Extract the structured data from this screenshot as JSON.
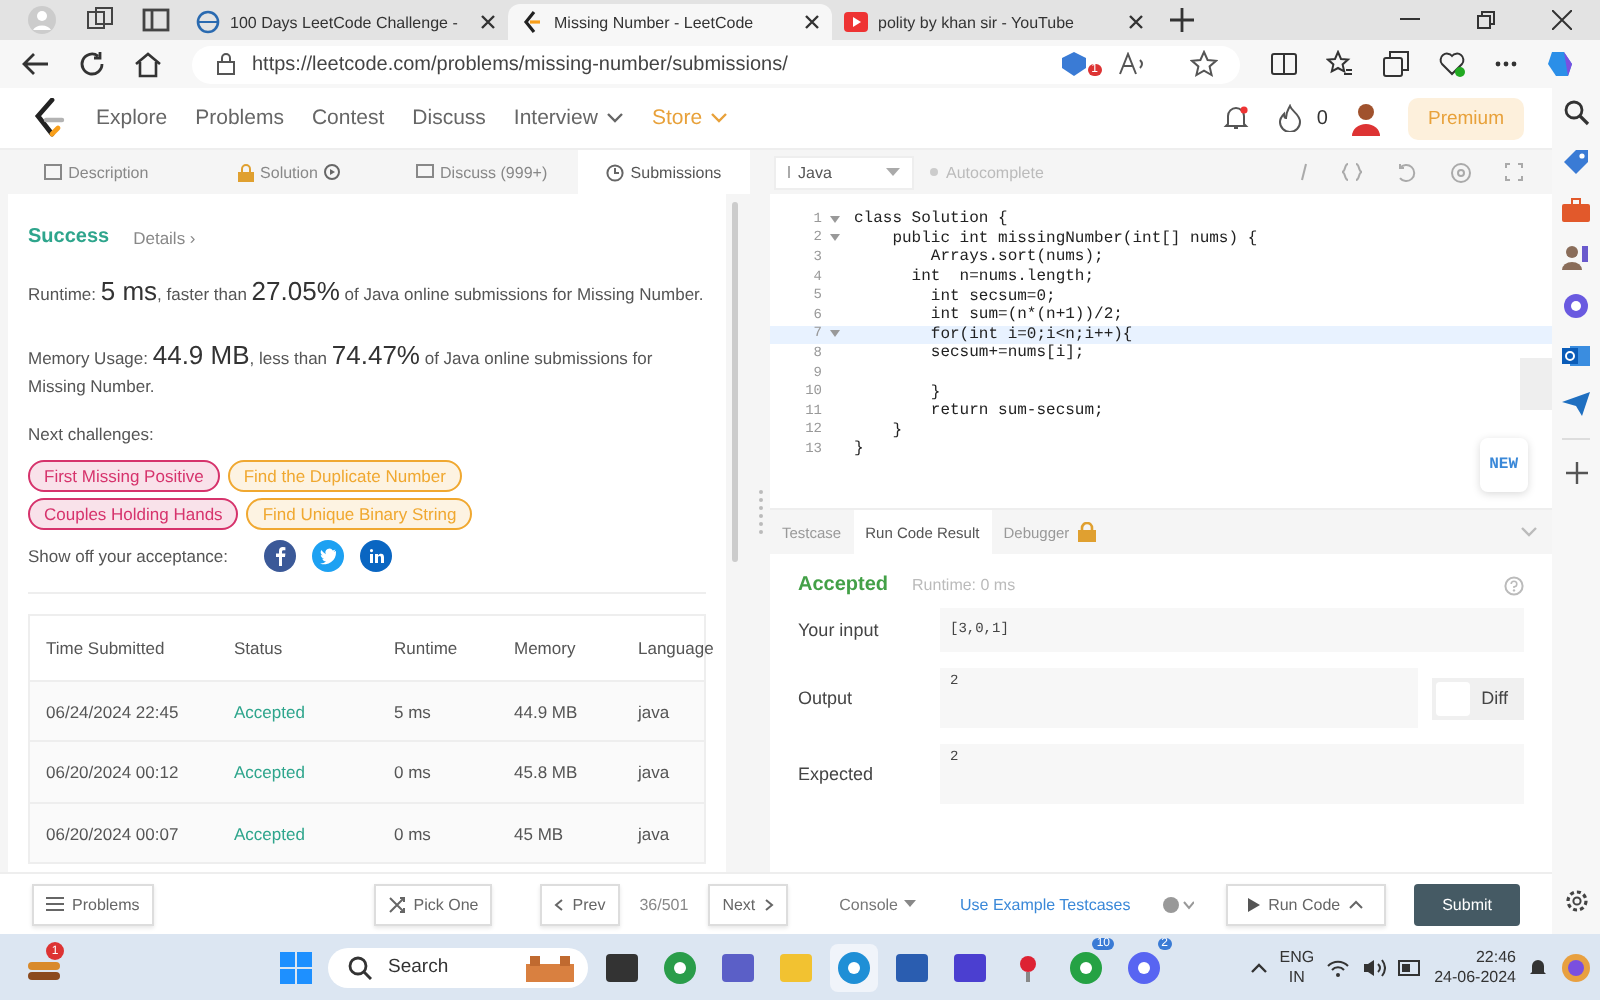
{
  "browser": {
    "tabs": [
      {
        "kind": "site",
        "title": "100 Days LeetCode Challenge -",
        "selected": false
      },
      {
        "kind": "leetcode",
        "title": "Missing Number - LeetCode",
        "selected": true
      },
      {
        "kind": "youtube",
        "title": "polity by khan sir - YouTube",
        "selected": false
      }
    ],
    "url": "https://leetcode.com/problems/missing-number/submissions/",
    "extension_badge": "1"
  },
  "nav": {
    "items": [
      {
        "label": "Explore",
        "dropdown": false,
        "kind": "plain"
      },
      {
        "label": "Problems",
        "dropdown": false,
        "kind": "plain"
      },
      {
        "label": "Contest",
        "dropdown": false,
        "kind": "plain"
      },
      {
        "label": "Discuss",
        "dropdown": false,
        "kind": "plain"
      },
      {
        "label": "Interview",
        "dropdown": true,
        "kind": "plain"
      },
      {
        "label": "Store",
        "dropdown": true,
        "kind": "store"
      }
    ],
    "streak": "0",
    "premium": "Premium"
  },
  "panel_tabs": [
    {
      "kind": "description",
      "label": "Description",
      "selected": false
    },
    {
      "kind": "solution",
      "label": "Solution",
      "selected": false
    },
    {
      "kind": "discuss",
      "label": "Discuss (999+)",
      "selected": false
    },
    {
      "kind": "submissions",
      "label": "Submissions",
      "selected": true
    }
  ],
  "result": {
    "status": "Success",
    "details": "Details ›",
    "runtime": "Runtime: **5 ms**, faster than **27.05%** of Java online submissions for Missing Number.",
    "memory": "Memory Usage: **44.9 MB**, less than **74.47%** of Java online submissions for Missing Number.",
    "next_label": "Next challenges:",
    "challenges": [
      {
        "label": "First Missing Positive",
        "color": "#d6336c"
      },
      {
        "label": "Find the Duplicate Number",
        "color": "#f0a830"
      },
      {
        "label": "Couples Holding Hands",
        "color": "#d6336c"
      },
      {
        "label": "Find Unique Binary String",
        "color": "#f0a830"
      }
    ],
    "share_label": "Show off your acceptance:",
    "share": [
      {
        "kind": "facebook"
      },
      {
        "kind": "twitter"
      },
      {
        "kind": "linkedin"
      }
    ]
  },
  "table": {
    "columns": [
      "Time Submitted",
      "Status",
      "Runtime",
      "Memory",
      "Language"
    ],
    "rows": [
      [
        "06/24/2024 22:45",
        "Accepted",
        "5 ms",
        "44.9 MB",
        "java"
      ],
      [
        "06/20/2024 00:12",
        "Accepted",
        "0 ms",
        "45.8 MB",
        "java"
      ],
      [
        "06/20/2024 00:07",
        "Accepted",
        "0 ms",
        "45 MB",
        "java"
      ]
    ]
  },
  "editor": {
    "language": "Java",
    "autocomplete": {
      "label": "Autocomplete",
      "on": false
    },
    "new_button": "NEW",
    "lines": [
      {
        "num": "1",
        "foldable": true,
        "highlighted": false,
        "text": "class Solution {"
      },
      {
        "num": "2",
        "foldable": true,
        "highlighted": false,
        "text": "    public int missingNumber(int[] nums) {"
      },
      {
        "num": "3",
        "foldable": false,
        "highlighted": false,
        "text": "        Arrays.sort(nums);"
      },
      {
        "num": "4",
        "foldable": false,
        "highlighted": false,
        "text": "      int  n=nums.length;"
      },
      {
        "num": "5",
        "foldable": false,
        "highlighted": false,
        "text": "        int secsum=0;"
      },
      {
        "num": "6",
        "foldable": false,
        "highlighted": false,
        "text": "        int sum=(n*(n+1))/2;"
      },
      {
        "num": "7",
        "foldable": true,
        "highlighted": true,
        "text": "        for(int i=0;i<n;i++){"
      },
      {
        "num": "8",
        "foldable": false,
        "highlighted": false,
        "text": "        secsum+=nums[i];"
      },
      {
        "num": "9",
        "foldable": false,
        "highlighted": false
      },
      {
        "num": "10",
        "foldable": false,
        "highlighted": false,
        "text": "        }"
      },
      {
        "num": "11",
        "foldable": false,
        "highlighted": false,
        "text": "        return sum-secsum;"
      },
      {
        "num": "12",
        "foldable": false,
        "highlighted": false,
        "text": "    }"
      },
      {
        "num": "13",
        "foldable": false,
        "highlighted": false,
        "text": "}"
      }
    ]
  },
  "console": {
    "tabs": [
      {
        "label": "Testcase",
        "selected": false,
        "locked": false
      },
      {
        "label": "Run Code Result",
        "selected": true,
        "locked": false
      },
      {
        "label": "Debugger",
        "selected": false,
        "locked": true
      }
    ],
    "expanded": true,
    "status": "Accepted",
    "runtime": "Runtime: 0 ms",
    "fields": [
      {
        "kind": "input",
        "label": "Your input",
        "value": "[3,0,1]"
      },
      {
        "kind": "output",
        "label": "Output",
        "value": "2"
      },
      {
        "kind": "expected",
        "label": "Expected",
        "value": "2"
      }
    ],
    "diff": {
      "label": "Diff",
      "on": false
    }
  },
  "bottom_bar": {
    "problems": "Problems",
    "pick_one": "Pick One",
    "prev": "Prev",
    "page": "36/501",
    "next": "Next",
    "console": "Console",
    "example": "Use Example Testcases",
    "run": "Run Code",
    "submit": "Submit"
  },
  "taskbar": {
    "weather_badge": "1",
    "search": "Search",
    "apps": [
      {
        "kind": "terminal",
        "active": false
      },
      {
        "kind": "chrome",
        "active": false
      },
      {
        "kind": "teams",
        "active": false
      },
      {
        "kind": "folder",
        "active": false
      },
      {
        "kind": "edge",
        "active": true
      },
      {
        "kind": "store",
        "active": false
      },
      {
        "kind": "editor",
        "active": false
      },
      {
        "kind": "pin",
        "active": false
      },
      {
        "kind": "whatsapp",
        "active": false,
        "badge": "10"
      },
      {
        "kind": "discord",
        "active": false,
        "badge": "2"
      }
    ],
    "lang": "ENG",
    "region": "IN",
    "time": "22:46",
    "date": "24-06-2024"
  }
}
